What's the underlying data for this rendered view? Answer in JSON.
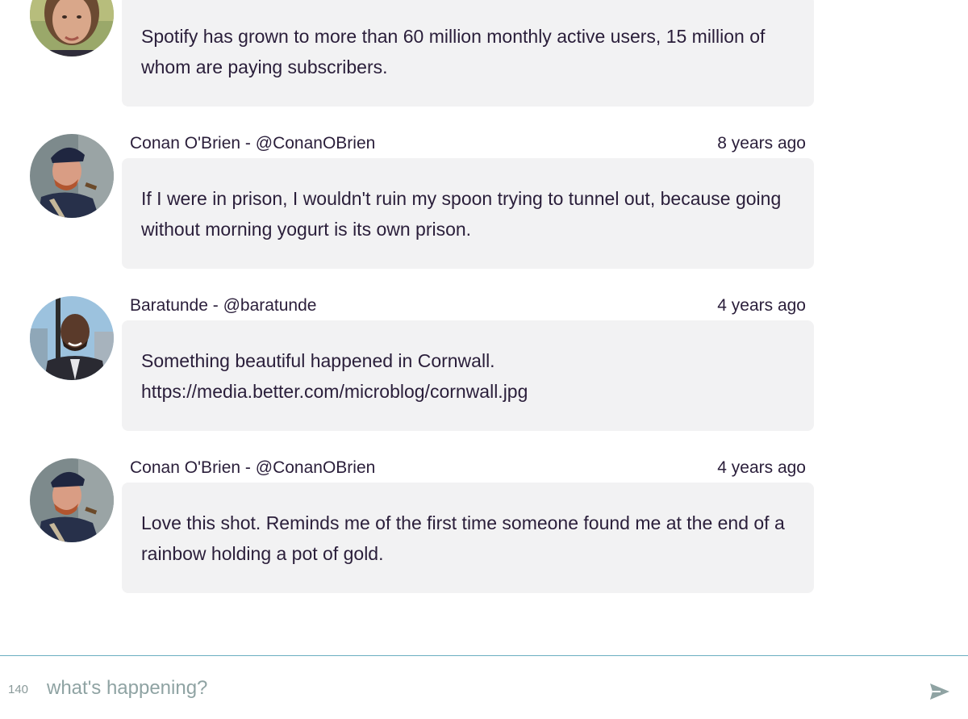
{
  "posts": [
    {
      "author": "",
      "time": "",
      "text": "Spotify has grown to more than 60 million monthly active users, 15 million of whom are paying subscribers.",
      "avatar": "woman-portrait-avatar"
    },
    {
      "author": "Conan O'Brien - @ConanOBrien",
      "time": "8 years ago",
      "text": "If I were in prison, I wouldn't ruin my spoon trying to tunnel out, because going without morning yogurt is its own prison.",
      "avatar": "conan-avatar"
    },
    {
      "author": "Baratunde - @baratunde",
      "time": "4 years ago",
      "text": "Something beautiful happened in Cornwall. https://media.better.com/microblog/cornwall.jpg",
      "avatar": "baratunde-avatar"
    },
    {
      "author": "Conan O'Brien - @ConanOBrien",
      "time": "4 years ago",
      "text": "Love this shot. Reminds me of the first time someone found me at the end of a rainbow holding a pot of gold.",
      "avatar": "conan-avatar"
    }
  ],
  "composer": {
    "char_count": "140",
    "placeholder": "what's happening?",
    "send_icon": "send-icon"
  },
  "colors": {
    "bubble": "#f2f2f3",
    "text": "#2a1e3a",
    "composer_border": "#6aaec0",
    "send_icon": "#8fa3a3"
  }
}
